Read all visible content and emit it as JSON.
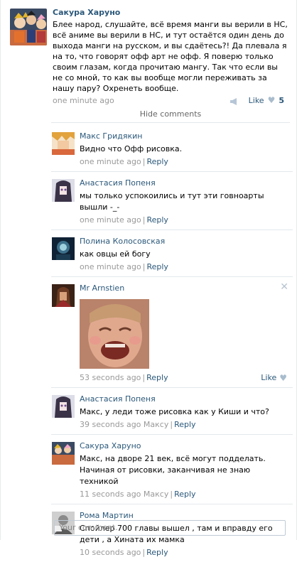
{
  "post": {
    "author": "Сакура Харуно",
    "text": "Блее народ, слушайте, всё время манги вы верили в НС, всё аниме вы верили в НС, и тут остаётся один день до выхода манги на русском, и вы сдаётесь?! Да плевала я на то, что говорят офф арт не офф. Я поверю только своим глазам, когда прочитаю мангу. Так что если вы не со мной, то как вы вообще могли переживать за нашу пару? Охренеть вообще.",
    "time": "one minute ago",
    "like_label": "Like",
    "like_count": "5"
  },
  "hide_comments_label": "Hide comments",
  "comments": [
    {
      "author": "Макс Гридякин",
      "text": "Видно что Офф рисовка.",
      "time": "one minute ago",
      "reply_to": "",
      "reply_label": "Reply"
    },
    {
      "author": "Анастасия Попеня",
      "text": "мы только успокоились и тут эти говноарты вышли -_-",
      "time": "one minute ago",
      "reply_to": "",
      "reply_label": "Reply"
    },
    {
      "author": "Полина Колосовская",
      "text": "как овцы ей богу",
      "time": "one minute ago",
      "reply_to": "",
      "reply_label": "Reply"
    },
    {
      "author": "Mr Arnstien",
      "text": "",
      "time": "53 seconds ago",
      "reply_to": "",
      "reply_label": "Reply",
      "like_label": "Like"
    },
    {
      "author": "Анастасия Попеня",
      "text": "Макс, у леди тоже рисовка как у Киши и что?",
      "time": "39 seconds ago",
      "reply_to": "Максу",
      "reply_label": "Reply"
    },
    {
      "author": "Сакура Харуно",
      "text": "Макс, на дворе 21 век, всё могут подделать. Начиная от рисовки, заканчивая не знаю техникой",
      "time": "11 seconds ago",
      "reply_to": "Максу",
      "reply_label": "Reply"
    },
    {
      "author": "Рома Мартин",
      "text": "Спойлер 700 главы вышел , там и вправду его дети , а Хината их мамка",
      "time": "10 seconds ago",
      "reply_to": "",
      "reply_label": "Reply"
    }
  ],
  "comment_input": {
    "placeholder": "Your comment.."
  },
  "colors": {
    "link": "#2b587a",
    "meta": "#999999",
    "divider": "#e4e8ed"
  }
}
